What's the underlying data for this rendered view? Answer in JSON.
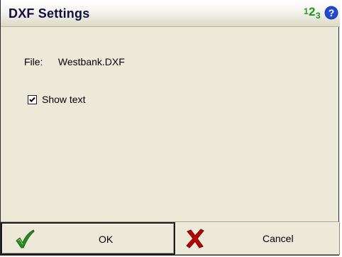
{
  "dialog": {
    "title": "DXF Settings",
    "input_mode_icon": "123-input-mode-icon",
    "help_icon": "question-mark-icon"
  },
  "file": {
    "label": "File:",
    "value": "Westbank.DXF"
  },
  "show_text": {
    "label": "Show text",
    "checked": true
  },
  "buttons": {
    "ok_label": "OK",
    "ok_icon": "green-checkmark-icon",
    "cancel_label": "Cancel",
    "cancel_icon": "red-x-icon"
  },
  "colors": {
    "background": "#ece9d8",
    "ok_icon": "#2e8b1f",
    "cancel_icon": "#c00000",
    "help_icon": "#1a3fb8",
    "input_mode_icon": "#1d9a1d"
  }
}
